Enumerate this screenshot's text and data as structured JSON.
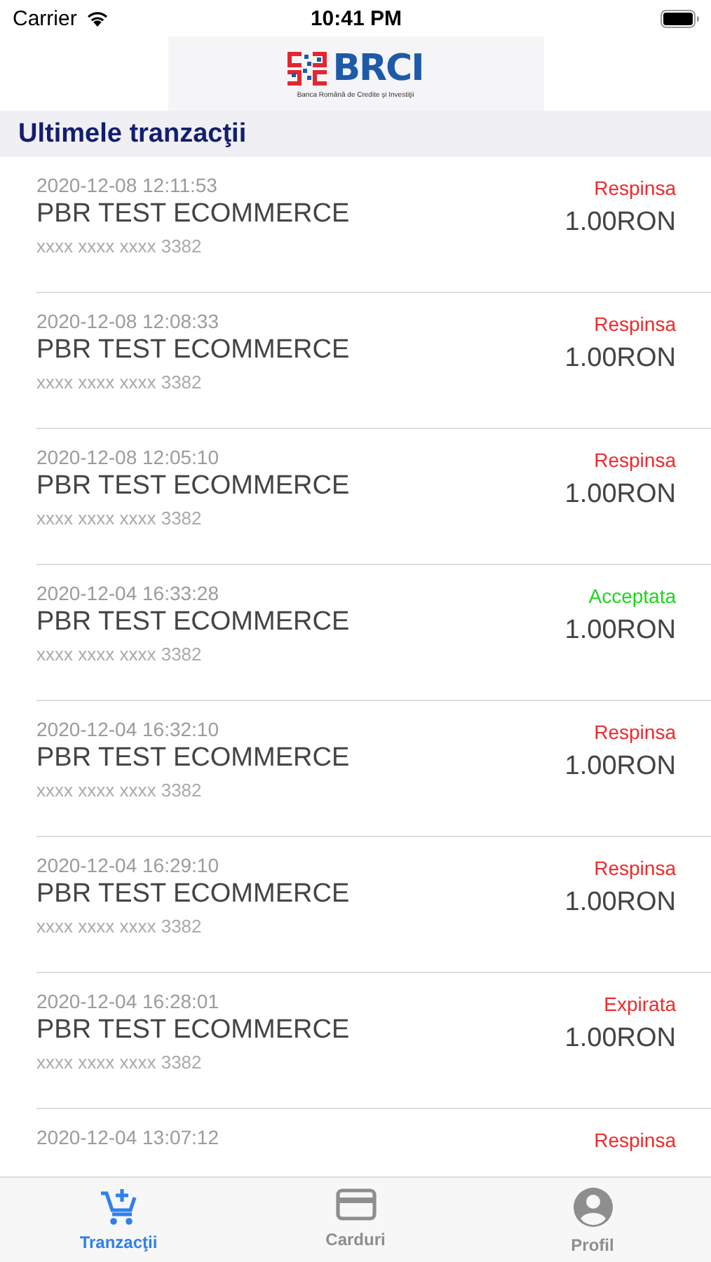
{
  "status_bar": {
    "carrier": "Carrier",
    "time": "10:41 PM"
  },
  "logo": {
    "name": "BRCI",
    "subtitle": "Banca Română de Credite şi Investiţii"
  },
  "section_title": "Ultimele tranzacţii",
  "transactions": [
    {
      "date": "2020-12-08 12:11:53",
      "merchant": "PBR TEST ECOMMERCE",
      "card": "xxxx xxxx xxxx 3382",
      "status": "Respinsa",
      "color": "#ee2a2a",
      "amount": "1.00RON"
    },
    {
      "date": "2020-12-08 12:08:33",
      "merchant": "PBR TEST ECOMMERCE",
      "card": "xxxx xxxx xxxx 3382",
      "status": "Respinsa",
      "color": "#ee2a2a",
      "amount": "1.00RON"
    },
    {
      "date": "2020-12-08 12:05:10",
      "merchant": "PBR TEST ECOMMERCE",
      "card": "xxxx xxxx xxxx 3382",
      "status": "Respinsa",
      "color": "#ee2a2a",
      "amount": "1.00RON"
    },
    {
      "date": "2020-12-04 16:33:28",
      "merchant": "PBR TEST ECOMMERCE",
      "card": "xxxx xxxx xxxx 3382",
      "status": "Acceptata",
      "color": "#1bd61b",
      "amount": "1.00RON"
    },
    {
      "date": "2020-12-04 16:32:10",
      "merchant": "PBR TEST ECOMMERCE",
      "card": "xxxx xxxx xxxx 3382",
      "status": "Respinsa",
      "color": "#ee2a2a",
      "amount": "1.00RON"
    },
    {
      "date": "2020-12-04 16:29:10",
      "merchant": "PBR TEST ECOMMERCE",
      "card": "xxxx xxxx xxxx 3382",
      "status": "Respinsa",
      "color": "#ee2a2a",
      "amount": "1.00RON"
    },
    {
      "date": "2020-12-04 16:28:01",
      "merchant": "PBR TEST ECOMMERCE",
      "card": "xxxx xxxx xxxx 3382",
      "status": "Expirata",
      "color": "#ee2a2a",
      "amount": "1.00RON"
    },
    {
      "date": "2020-12-04 13:07:12",
      "status": "Respinsa",
      "color": "#ee2a2a"
    }
  ],
  "tabs": [
    {
      "label": "Tranzacţii",
      "selected": true
    },
    {
      "label": "Carduri",
      "selected": false
    },
    {
      "label": "Profil",
      "selected": false
    }
  ]
}
